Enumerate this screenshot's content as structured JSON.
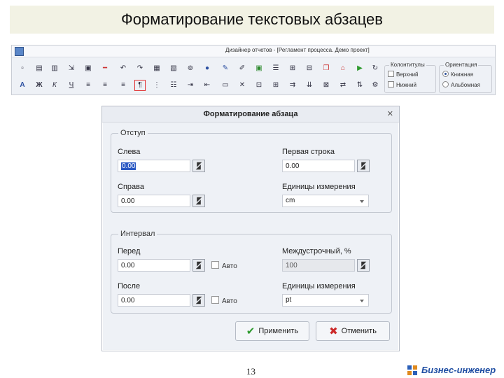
{
  "slide": {
    "title": "Форматирование текстовых абзацев",
    "page_number": "13",
    "brand": "Бизнес-инженер"
  },
  "app": {
    "window_title": "Дизайнер отчетов - [Регламент процесса. Демо проект]",
    "header_group": {
      "title": "Колонтитулы",
      "options": [
        "Верхний",
        "Нижний"
      ]
    },
    "orientation_group": {
      "title": "Ориентация",
      "options": [
        "Книжная",
        "Альбомная"
      ],
      "selected": "Книжная"
    }
  },
  "dialog": {
    "title": "Форматирование абзаца",
    "indent": {
      "legend": "Отступ",
      "left_label": "Слева",
      "left_value": "0.00",
      "first_line_label": "Первая строка",
      "first_line_value": "0.00",
      "right_label": "Справа",
      "right_value": "0.00",
      "units_label": "Единицы измерения",
      "units_value": "cm"
    },
    "interval": {
      "legend": "Интервал",
      "before_label": "Перед",
      "before_value": "0.00",
      "before_auto": "Авто",
      "line_spacing_label": "Междустрочный, %",
      "line_spacing_value": "100",
      "after_label": "После",
      "after_value": "0.00",
      "after_auto": "Авто",
      "units_label": "Единицы измерения",
      "units_value": "pt"
    },
    "apply_label": "Применить",
    "cancel_label": "Отменить"
  }
}
